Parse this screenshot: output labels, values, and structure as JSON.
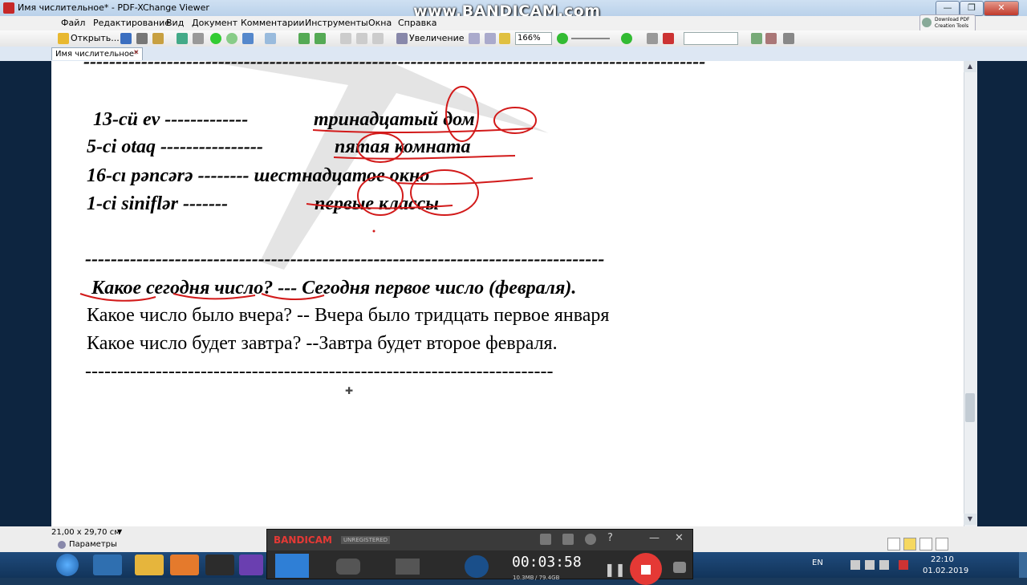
{
  "window": {
    "title": "Имя числительное* - PDF-XChange Viewer",
    "watermark": "www.BANDICAM.com"
  },
  "menu": [
    "Файл",
    "Редактирование",
    "Вид",
    "Документ",
    "Комментарии",
    "Инструменты",
    "Окна",
    "Справка"
  ],
  "toolbar": {
    "open_label": "Открыть...",
    "zoom_in_label": "Увеличение",
    "zoom_value": "166%",
    "download_label_1": "Download PDF",
    "download_label_2": "Creation Tools"
  },
  "tab": {
    "label": "Имя числительное*"
  },
  "document": {
    "top_dashes": "-------------------------------------------------------------------------------------------------",
    "rows": [
      {
        "left": "13-cü ev -------------",
        "right": "тринадцатый   дом"
      },
      {
        "left": "5-ci otaq  ----------------",
        "right": "пятая  комната"
      },
      {
        "left": "16-cı  pəncərə -------- шестнадцатое  окно",
        "right": ""
      },
      {
        "left": "1-ci  siniflər  -------",
        "right": "первые   классы"
      }
    ],
    "separator": "---------------------------------------------------------------------------------",
    "question_bold": "Какое   сегодня  число? ---   Сегодня   первое  число (февраля).",
    "line2": "Какое  число было вчера? -- Вчера было тридцать первое января",
    "line3": "Какое число будет завтра? --Завтра будет второе февраля.",
    "bottom_dashes": "-------------------------------------------------------------------------"
  },
  "status": {
    "page_size": "21,00 x 29,70 см",
    "params_label": "Параметры"
  },
  "bandicam": {
    "logo": "BANDICAM",
    "unregistered": "UNREGISTERED",
    "timer": "00:03:58",
    "file_info_1": "10.3MB",
    "file_info_2": "/ 79.4GB"
  },
  "tray": {
    "lang": "EN",
    "time": "22:10",
    "date": "01.02.2019"
  },
  "colors": {
    "ink": "#000000",
    "annotation": "#d21a1a",
    "titlebar": "#c6dbf0",
    "taskbar": "#12345a"
  }
}
